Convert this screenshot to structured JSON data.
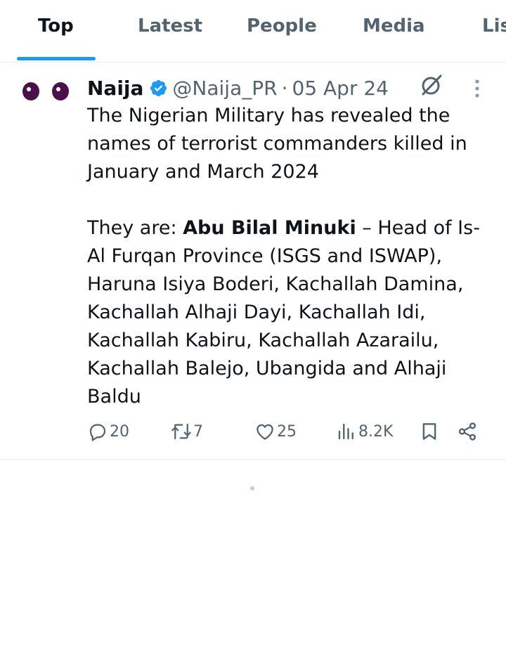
{
  "tabs": [
    {
      "label": "Top",
      "active": true
    },
    {
      "label": "Latest"
    },
    {
      "label": "People"
    },
    {
      "label": "Media"
    },
    {
      "label": "Lis"
    }
  ],
  "tweet": {
    "author_name": "Naija",
    "handle": "@Naija_PR",
    "separator": "·",
    "date": "05 Apr 24",
    "text_line1": "The Nigerian Military has revealed the names of terrorist commanders killed in January and March 2024",
    "text_intro": "They are: ",
    "text_bold": "Abu Bilal Minuki",
    "text_rest": " – Head of Is-Al Furqan Province (ISGS and ISWAP), Haruna Isiya Boderi, Kachallah Damina, Kachallah Alhaji Dayi, Kachallah Idi, Kachallah Kabiru, Kachallah Azarailu, Kachallah Balejo, Ubangida and Alhaji Baldu",
    "stats": {
      "replies": "20",
      "reposts": "7",
      "likes": "25",
      "views": "8.2K"
    }
  },
  "colors": {
    "accent": "#1d9bf0",
    "muted": "#536471",
    "avatar_eye": "#4b0f4a"
  },
  "icons": [
    "verified-badge-icon",
    "grok-icon",
    "more-icon",
    "reply-icon",
    "repost-icon",
    "like-icon",
    "views-icon",
    "bookmark-icon",
    "share-icon"
  ]
}
